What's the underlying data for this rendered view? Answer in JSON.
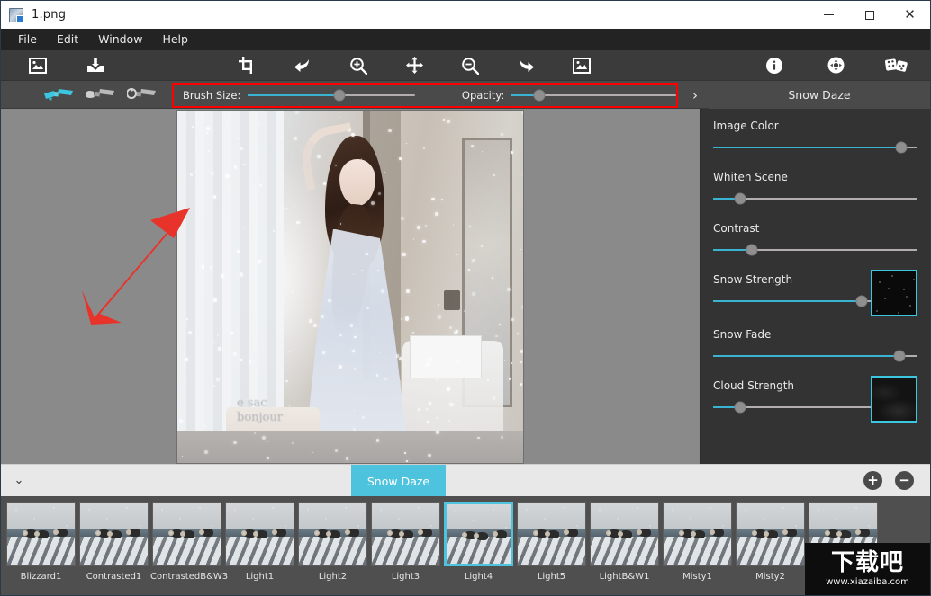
{
  "window": {
    "title": "1.png",
    "icon": "image-file-icon",
    "minimize_label": "Minimize",
    "maximize_label": "Maximize",
    "close_label": "Close"
  },
  "menu": {
    "items": [
      {
        "label": "File"
      },
      {
        "label": "Edit"
      },
      {
        "label": "Window"
      },
      {
        "label": "Help"
      }
    ]
  },
  "toolbar": {
    "left_tools": [
      {
        "name": "open-image-icon",
        "title": "Open Image"
      },
      {
        "name": "save-image-icon",
        "title": "Save Image"
      }
    ],
    "center_tools": [
      {
        "name": "crop-icon",
        "title": "Crop"
      },
      {
        "name": "undo-icon",
        "title": "Undo"
      },
      {
        "name": "zoom-in-icon",
        "title": "Zoom In"
      },
      {
        "name": "move-icon",
        "title": "Pan"
      },
      {
        "name": "zoom-out-icon",
        "title": "Zoom Out"
      },
      {
        "name": "redo-icon",
        "title": "Redo"
      },
      {
        "name": "fit-image-icon",
        "title": "Fit Image"
      }
    ],
    "right_tools": [
      {
        "name": "info-icon",
        "title": "Info"
      },
      {
        "name": "settings-icon",
        "title": "Settings"
      },
      {
        "name": "random-icon",
        "title": "Randomize"
      }
    ]
  },
  "options_bar": {
    "brush_tools": [
      {
        "name": "paint-brush-icon",
        "title": "Paint",
        "active": true
      },
      {
        "name": "erase-brush-icon",
        "title": "Erase",
        "active": false
      },
      {
        "name": "reset-brush-icon",
        "title": "Reset Brush",
        "active": false
      }
    ],
    "brush_size": {
      "label": "Brush Size:",
      "percent": 55
    },
    "opacity": {
      "label": "Opacity:",
      "percent": 17
    },
    "expand_label": "›",
    "preset_name": "Snow Daze",
    "highlight_color": "#fe0000"
  },
  "canvas": {
    "photo_caption_line1": "e sac",
    "photo_caption_line2": "bonjour",
    "annotation": "red-arrow-pointing-to-brush-options"
  },
  "right_panel": {
    "controls": [
      {
        "label": "Image Color",
        "percent": 92,
        "preview": null
      },
      {
        "label": "Whiten Scene",
        "percent": 13,
        "preview": null
      },
      {
        "label": "Contrast",
        "percent": 19,
        "preview": null
      },
      {
        "label": "Snow Strength",
        "percent": 94,
        "preview": "snow-preview"
      },
      {
        "label": "Snow Fade",
        "percent": 91,
        "preview": null
      },
      {
        "label": "Cloud Strength",
        "percent": 17,
        "preview": "cloud-preview"
      }
    ],
    "accent_color": "#3cc7e0"
  },
  "filter_bar": {
    "collapse_label": "⌄",
    "active_tab": "Snow Daze",
    "add_label": "+",
    "remove_label": "−"
  },
  "thumbnails": {
    "selected": "Light4",
    "items": [
      {
        "label": "Blizzard1"
      },
      {
        "label": "Contrasted1"
      },
      {
        "label": "ContrastedB&W3"
      },
      {
        "label": "Light1"
      },
      {
        "label": "Light2"
      },
      {
        "label": "Light3"
      },
      {
        "label": "Light4"
      },
      {
        "label": "Light5"
      },
      {
        "label": "LightB&W1"
      },
      {
        "label": "Misty1"
      },
      {
        "label": "Misty2"
      },
      {
        "label": ""
      }
    ]
  },
  "watermark": {
    "cn": "下载吧",
    "url": "www.xiazaiba.com"
  }
}
